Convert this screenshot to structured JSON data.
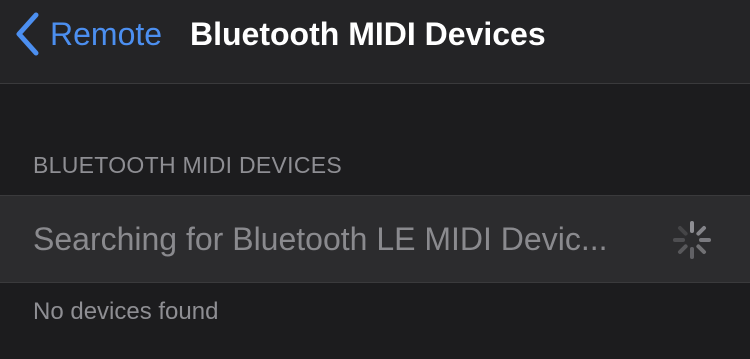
{
  "nav": {
    "back_label": "Remote",
    "title": "Bluetooth MIDI Devices"
  },
  "section": {
    "header": "BLUETOOTH MIDI DEVICES",
    "status_text": "Searching for Bluetooth LE MIDI Devic...",
    "footer": "No devices found"
  },
  "icons": {
    "back": "chevron-left-icon",
    "spinner": "activity-spinner-icon"
  },
  "colors": {
    "accent": "#4c8ff0",
    "background": "#1c1c1e",
    "row_background": "#2c2c2e",
    "secondary_text": "#8e8e93"
  }
}
